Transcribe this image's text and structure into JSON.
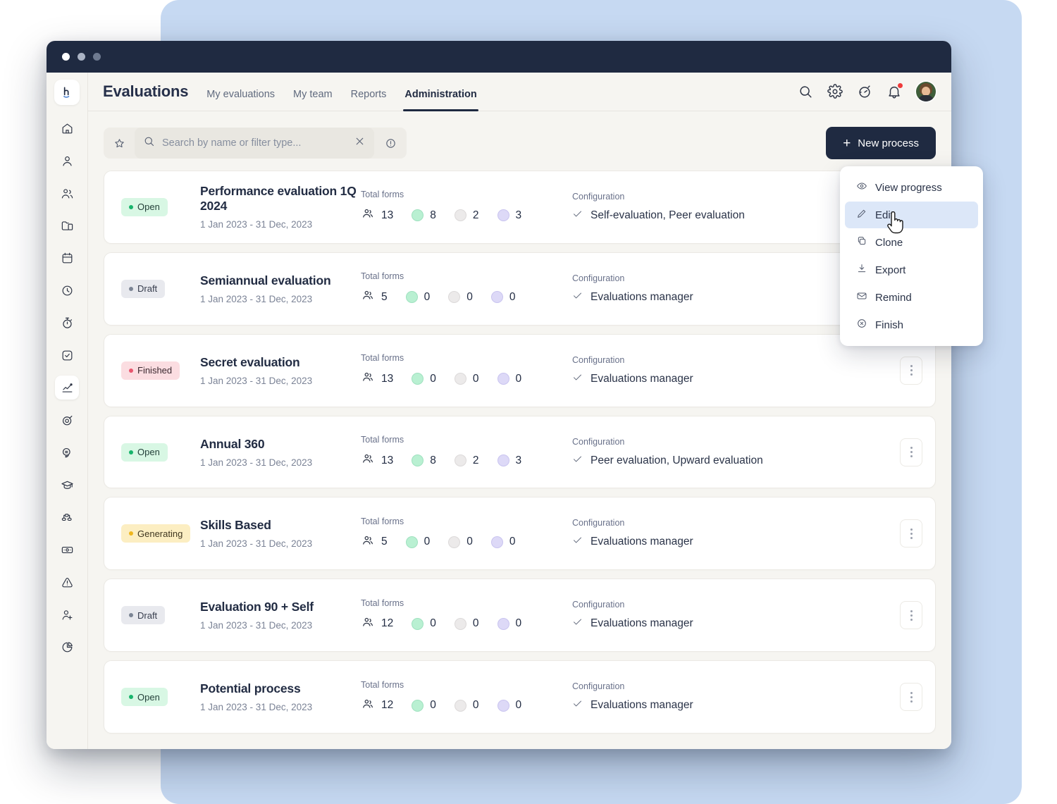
{
  "window": {
    "dots": [
      "close",
      "minimize",
      "maximize"
    ]
  },
  "header": {
    "brand": "Evaluations",
    "nav": [
      {
        "label": "My evaluations",
        "active": false
      },
      {
        "label": "My team",
        "active": false
      },
      {
        "label": "Reports",
        "active": false
      },
      {
        "label": "Administration",
        "active": true
      }
    ],
    "icons": [
      "search-icon",
      "gear-icon",
      "stopwatch-icon",
      "bell-icon"
    ],
    "avatar": "user-avatar"
  },
  "search": {
    "placeholder": "Search by name or filter type...",
    "value": "",
    "star_icon": "star-icon",
    "search_icon": "search-icon",
    "clear_icon": "close-icon",
    "info_icon": "info-icon"
  },
  "toolbar": {
    "new_process_label": "New process",
    "plus_icon": "plus-icon"
  },
  "labels": {
    "total_forms": "Total forms",
    "configuration": "Configuration"
  },
  "sidebar": {
    "logo": "h-logo",
    "items": [
      {
        "name": "home",
        "active": false
      },
      {
        "name": "profile",
        "active": false
      },
      {
        "name": "people",
        "active": false
      },
      {
        "name": "folder",
        "active": false
      },
      {
        "name": "calendar",
        "active": false
      },
      {
        "name": "clock",
        "active": false
      },
      {
        "name": "timer",
        "active": false
      },
      {
        "name": "task-check",
        "active": false
      },
      {
        "name": "analytics",
        "active": true
      },
      {
        "name": "target",
        "active": false
      },
      {
        "name": "feedback",
        "active": false
      },
      {
        "name": "learning",
        "active": false
      },
      {
        "name": "workflow",
        "active": false
      },
      {
        "name": "payroll",
        "active": false
      },
      {
        "name": "alert",
        "active": false
      },
      {
        "name": "add-user",
        "active": false
      },
      {
        "name": "reports-pie",
        "active": false
      }
    ]
  },
  "colors": {
    "accent_dark": "#1f2a41",
    "background_blue": "#c6d9f2",
    "app_background": "#f6f5f1",
    "status_open": "#17b46b",
    "status_draft": "#7b8494",
    "status_finished": "#e8566e",
    "status_generating": "#efb61d",
    "menu_highlight": "#dce7f8"
  },
  "rows": [
    {
      "status": "Open",
      "status_kind": "open",
      "title": "Performance evaluation 1Q 2024",
      "date": "1 Jan 2023 - 31 Dec, 2023",
      "total": "13",
      "green": "8",
      "grey": "2",
      "purple": "3",
      "configuration": "Self-evaluation, Peer evaluation"
    },
    {
      "status": "Draft",
      "status_kind": "draft",
      "title": "Semiannual evaluation",
      "date": "1 Jan 2023 - 31 Dec, 2023",
      "total": "5",
      "green": "0",
      "grey": "0",
      "purple": "0",
      "configuration": "Evaluations manager"
    },
    {
      "status": "Finished",
      "status_kind": "finished",
      "title": "Secret evaluation",
      "date": "1 Jan 2023 - 31 Dec, 2023",
      "total": "13",
      "green": "0",
      "grey": "0",
      "purple": "0",
      "configuration": "Evaluations manager"
    },
    {
      "status": "Open",
      "status_kind": "open",
      "title": "Annual 360",
      "date": "1 Jan 2023 - 31 Dec, 2023",
      "total": "13",
      "green": "8",
      "grey": "2",
      "purple": "3",
      "configuration": "Peer evaluation, Upward evaluation"
    },
    {
      "status": "Generating",
      "status_kind": "generating",
      "title": "Skills Based",
      "date": "1 Jan 2023 - 31 Dec, 2023",
      "total": "5",
      "green": "0",
      "grey": "0",
      "purple": "0",
      "configuration": "Evaluations manager"
    },
    {
      "status": "Draft",
      "status_kind": "draft",
      "title": "Evaluation 90 + Self",
      "date": "1 Jan 2023 - 31 Dec, 2023",
      "total": "12",
      "green": "0",
      "grey": "0",
      "purple": "0",
      "configuration": "Evaluations manager"
    },
    {
      "status": "Open",
      "status_kind": "open",
      "title": "Potential process",
      "date": "1 Jan 2023 - 31 Dec, 2023",
      "total": "12",
      "green": "0",
      "grey": "0",
      "purple": "0",
      "configuration": "Evaluations manager"
    }
  ],
  "context_menu": {
    "items": [
      {
        "label": "View progress",
        "icon": "eye-icon",
        "highlighted": false
      },
      {
        "label": "Edit",
        "icon": "pencil-icon",
        "highlighted": true
      },
      {
        "label": "Clone",
        "icon": "copy-icon",
        "highlighted": false
      },
      {
        "label": "Export",
        "icon": "download-icon",
        "highlighted": false
      },
      {
        "label": "Remind",
        "icon": "envelope-icon",
        "highlighted": false
      },
      {
        "label": "Finish",
        "icon": "circle-x-icon",
        "highlighted": false
      }
    ]
  }
}
